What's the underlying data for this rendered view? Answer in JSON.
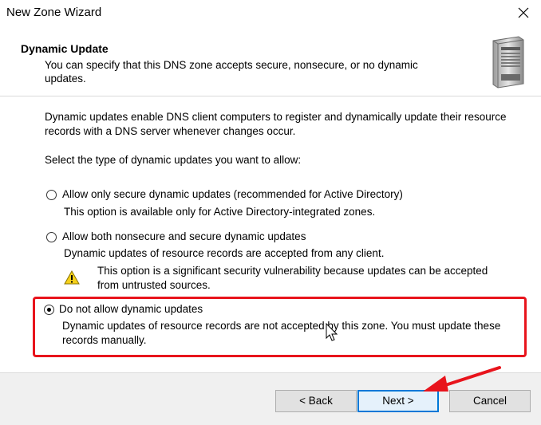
{
  "window": {
    "title": "New Zone Wizard"
  },
  "header": {
    "title": "Dynamic Update",
    "subtitle": "You can specify that this DNS zone accepts secure, nonsecure, or no dynamic updates."
  },
  "content": {
    "intro": "Dynamic updates enable DNS client computers to register and dynamically update their resource records with a DNS server whenever changes occur.",
    "prompt": "Select the type of dynamic updates you want to allow:",
    "options": [
      {
        "label": "Allow only secure dynamic updates (recommended for Active Directory)",
        "description": "This option is available only for Active Directory-integrated zones.",
        "selected": false
      },
      {
        "label": "Allow both nonsecure and secure dynamic updates",
        "description": "Dynamic updates of resource records are accepted from any client.",
        "warning": "This option is a significant security vulnerability because updates can be accepted from untrusted sources.",
        "selected": false
      },
      {
        "label": "Do not allow dynamic updates",
        "description": "Dynamic updates of resource records are not accepted by this zone. You must update these records manually.",
        "selected": true
      }
    ]
  },
  "footer": {
    "back_label": "< Back",
    "next_label": "Next >",
    "cancel_label": "Cancel"
  },
  "icons": {
    "close": "close-icon",
    "server": "server-icon",
    "warning": "warning-icon",
    "cursor": "mouse-cursor-icon",
    "arrow": "red-arrow-icon"
  },
  "colors": {
    "highlight": "#e8141c",
    "accent": "#0078d7",
    "footer_bg": "#f0f0f0"
  }
}
